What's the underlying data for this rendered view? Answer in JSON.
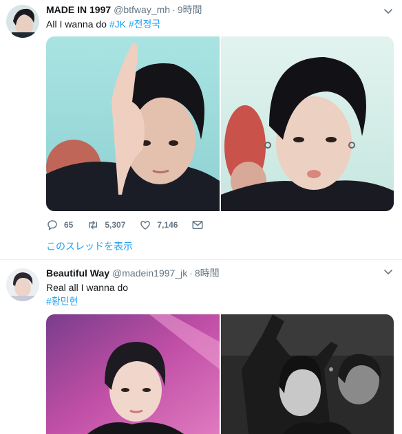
{
  "tweets": [
    {
      "display_name": "MADE IN 1997",
      "handle": "@btfway_mh",
      "time": "9時間",
      "text_plain": "All I wanna do ",
      "hashtags": [
        "#JK",
        "#전정국"
      ],
      "stats": {
        "replies": "65",
        "retweets": "5,307",
        "likes": "7,146"
      },
      "thread_link": "このスレッドを表示"
    },
    {
      "display_name": "Beautiful Way",
      "handle": "@madein1997_jk",
      "time": "8時間",
      "text_plain": "Real all I wanna do",
      "hashtags": [
        "#황민현"
      ]
    }
  ],
  "separator": "·",
  "colors": {
    "link": "#1da1f2",
    "muted": "#657786",
    "text": "#14171a",
    "divider": "#e6ecf0"
  },
  "icons": [
    "reply-icon",
    "retweet-icon",
    "like-icon",
    "dm-icon",
    "caret-down-icon"
  ]
}
